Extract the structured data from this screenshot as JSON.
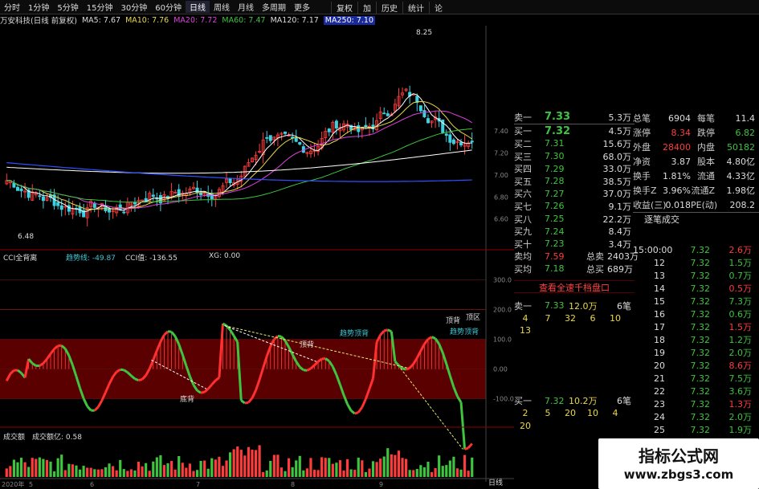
{
  "tabs": [
    "分时",
    "1分钟",
    "5分钟",
    "15分钟",
    "30分钟",
    "60分钟",
    "日线",
    "周线",
    "月线",
    "多周期",
    "更多"
  ],
  "active_tab": "日线",
  "right_tabs": [
    "复权",
    "加",
    "历史",
    "统计",
    "论"
  ],
  "ma_bar": {
    "title": "万安科技(日线 前复权)",
    "ma5": "MA5: 7.67",
    "ma10": "MA10: 7.76",
    "ma20": "MA20: 7.72",
    "ma60": "MA60: 7.47",
    "ma120": "MA120: 7.17",
    "ma250": "MA250: 7.10"
  },
  "price_axis": [
    "7.40",
    "7.20",
    "7.00",
    "6.80",
    "6.60"
  ],
  "high_label": "8.25",
  "low_label": "6.48",
  "cci_bar": {
    "title": "CCI全背离",
    "trend": "趋势线: -49.87",
    "cci": "CCI值: -136.55",
    "xg": "XG: 0.00"
  },
  "cci_axis": [
    "300.0",
    "200.0",
    "100.0",
    "0.00",
    "-100.0"
  ],
  "cci_notes": {
    "n1": "顶背",
    "n2": "趋势顶背",
    "n3": "顶背",
    "n4": "趋势顶背",
    "n5": "底背",
    "top": "顶区"
  },
  "vol_bar": {
    "title": "成交额",
    "sub": "成交额亿: 0.58"
  },
  "date_axis": [
    "2020年",
    "5",
    "6",
    "7",
    "8",
    "9"
  ],
  "period_label": "日线",
  "quote": {
    "sells": [
      {
        "n": "卖一",
        "p": "7.33",
        "v": "5.3万",
        "c": "r"
      }
    ],
    "buys": [
      {
        "n": "买一",
        "p": "7.32",
        "v": "4.5万",
        "c": "r"
      },
      {
        "n": "买二",
        "p": "7.31",
        "v": "15.6万",
        "c": "r"
      },
      {
        "n": "买三",
        "p": "7.30",
        "v": "68.0万",
        "c": "r"
      },
      {
        "n": "买四",
        "p": "7.29",
        "v": "33.0万",
        "c": "r"
      },
      {
        "n": "买五",
        "p": "7.28",
        "v": "38.5万",
        "c": "r"
      },
      {
        "n": "买六",
        "p": "7.27",
        "v": "37.0万",
        "c": "r"
      },
      {
        "n": "买七",
        "p": "7.26",
        "v": "9.1万",
        "c": "r"
      },
      {
        "n": "买八",
        "p": "7.25",
        "v": "22.2万",
        "c": "r"
      },
      {
        "n": "买九",
        "p": "7.24",
        "v": "8.4万",
        "c": "r"
      },
      {
        "n": "买十",
        "p": "7.23",
        "v": "3.4万",
        "c": "r"
      }
    ],
    "avg_sell": {
      "n": "卖均",
      "p": "7.59",
      "k": "总卖",
      "v": "2403万"
    },
    "avg_buy": {
      "n": "买均",
      "p": "7.18",
      "k": "总买",
      "v": "689万"
    },
    "link": "查看全速千档盘口",
    "sell1": {
      "n": "卖一",
      "p": "7.33",
      "q": "12.0万",
      "cnt": "6笔"
    },
    "sell1_rows": [
      [
        "4",
        "7",
        "32",
        "6",
        "10"
      ],
      [
        "13"
      ]
    ],
    "buy1": {
      "n": "买一",
      "p": "7.32",
      "q": "10.2万",
      "cnt": "6笔"
    },
    "buy1_rows": [
      [
        "2",
        "5",
        "20",
        "10",
        "4"
      ],
      [
        "20"
      ]
    ]
  },
  "stats": {
    "rows": [
      {
        "k": "总笔",
        "a": "6904",
        "k2": "每笔",
        "b": "11.4"
      },
      {
        "k": "涨停",
        "a": "8.34",
        "k2": "跌停",
        "b": "6.82"
      },
      {
        "k": "外盘",
        "a": "28400",
        "k2": "内盘",
        "b": "50182"
      },
      {
        "k": "净资",
        "a": "3.87",
        "k2": "股本",
        "b": "4.80亿"
      },
      {
        "k": "换手",
        "a": "1.81%",
        "k2": "流通",
        "b": "4.33亿"
      },
      {
        "k": "换手Z",
        "a": "3.96%",
        "k2": "流通Z",
        "b": "1.98亿"
      },
      {
        "k": "收益(三)",
        "a": "0.018",
        "k2": "PE(动)",
        "b": "208.2"
      }
    ],
    "section": "逐笔成交"
  },
  "ticks": [
    {
      "t": "15:00:00",
      "p": "7.32",
      "v": "2.6万"
    },
    {
      "t": "12",
      "p": "7.32",
      "v": "1.5万"
    },
    {
      "t": "13",
      "p": "7.32",
      "v": "0.7万"
    },
    {
      "t": "14",
      "p": "7.32",
      "v": "0.5万"
    },
    {
      "t": "15",
      "p": "7.32",
      "v": "7.3万"
    },
    {
      "t": "16",
      "p": "7.32",
      "v": "0.6万"
    },
    {
      "t": "17",
      "p": "7.32",
      "v": "1.5万"
    },
    {
      "t": "18",
      "p": "7.32",
      "v": "1.2万"
    },
    {
      "t": "19",
      "p": "7.32",
      "v": "2.0万"
    },
    {
      "t": "20",
      "p": "7.32",
      "v": "8.6万"
    },
    {
      "t": "21",
      "p": "7.32",
      "v": "7.5万"
    },
    {
      "t": "22",
      "p": "7.32",
      "v": "3.6万"
    },
    {
      "t": "23",
      "p": "7.32",
      "v": "1.3万"
    },
    {
      "t": "24",
      "p": "7.32",
      "v": "2.0万"
    },
    {
      "t": "25",
      "p": "7.32",
      "v": "1.9万"
    }
  ],
  "watermark": {
    "cn": "指标公式网",
    "url": "www.zbgs3.com"
  },
  "colors": {
    "up": "#ff3c3c",
    "down": "#3ec43e",
    "bg": "#000000",
    "cci_band": "#8b0000",
    "ma5": "#ffffff",
    "ma10": "#e8d84a",
    "ma20": "#e040e0",
    "ma60": "#3ec43e",
    "ma120": "#ffffff",
    "ma250": "#3050ff"
  }
}
